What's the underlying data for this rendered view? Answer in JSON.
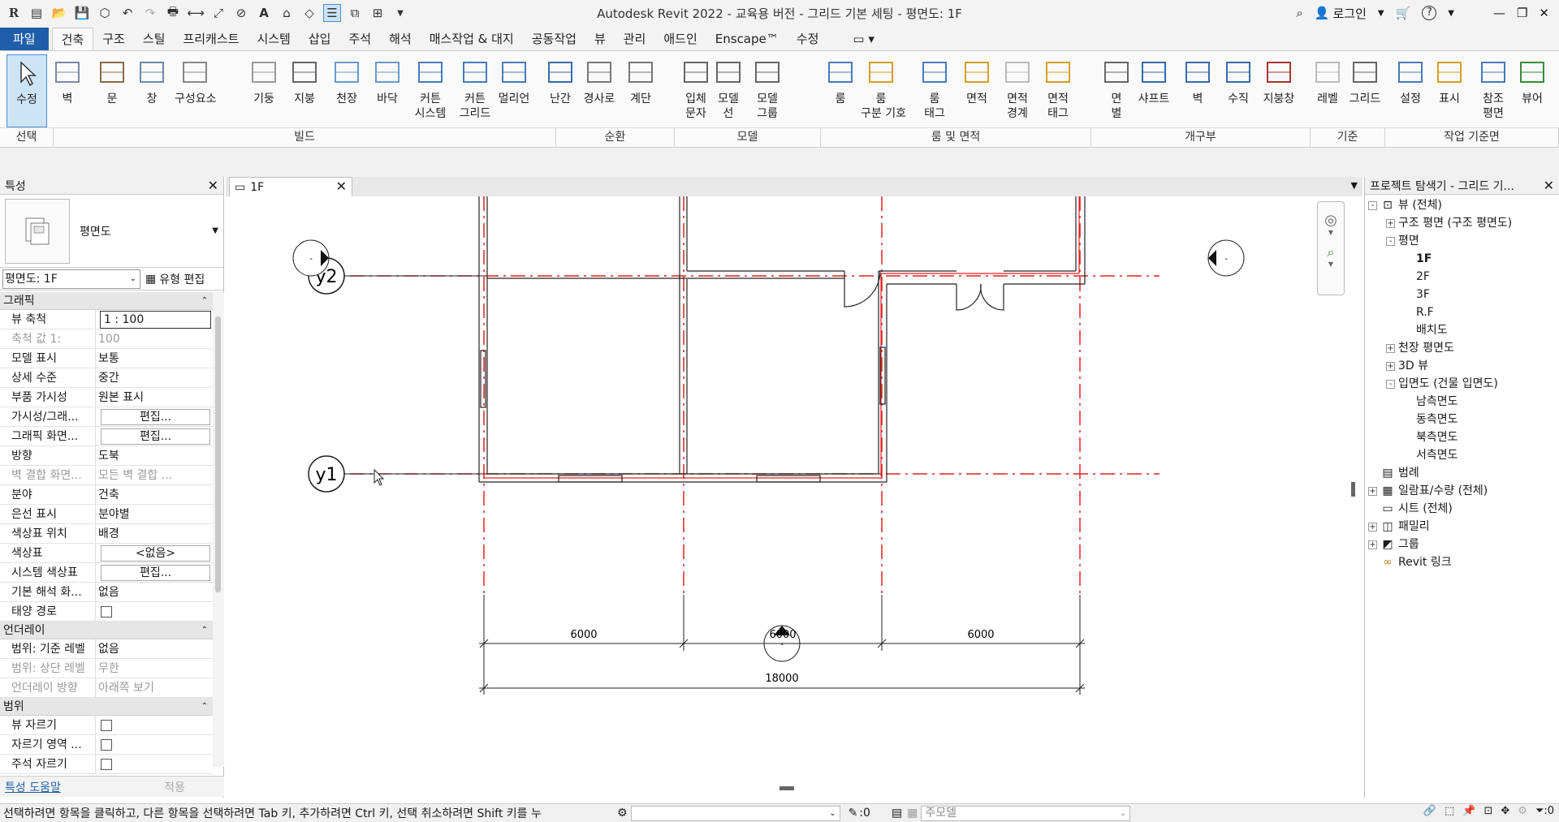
{
  "window": {
    "title": "Autodesk Revit 2022 - 교육용 버전 - 그리드 기본 세팅 - 평면도: 1F",
    "login": "로그인",
    "help": "?"
  },
  "menu": [
    "파일",
    "건축",
    "구조",
    "스틸",
    "프리캐스트",
    "시스템",
    "삽입",
    "주석",
    "해석",
    "매스작업 & 대지",
    "공동작업",
    "뷰",
    "관리",
    "애드인",
    "Enscape™",
    "수정"
  ],
  "ribbon": {
    "buttons": [
      "수정",
      "벽",
      "문",
      "창",
      "구성요소",
      "기둥",
      "지붕",
      "천장",
      "바닥",
      "커튼\n시스템",
      "커튼\n그리드",
      "멀리언",
      "난간",
      "경사로",
      "계단",
      "입체\n문자",
      "모델\n선",
      "모델\n그룹",
      "룸",
      "룸\n구분 기호",
      "룸\n태그",
      "면적",
      "면적\n경계",
      "면적\n태그",
      "면\n별",
      "샤프트",
      "벽",
      "수직",
      "지붕창",
      "레벨",
      "그리드",
      "설정",
      "표시",
      "참조\n평면",
      "뷰어"
    ],
    "panels": [
      "선택",
      "빌드",
      "순환",
      "모델",
      "룸 및 면적",
      "개구부",
      "기준",
      "작업 기준면"
    ]
  },
  "properties": {
    "title": "특성",
    "type_name": "평면도",
    "instance": "평면도: 1F",
    "edit_type": "유형 편집",
    "groups": [
      {
        "name": "그래픽",
        "rows": [
          {
            "k": "뷰 축척",
            "v": "1 : 100",
            "style": "boxed"
          },
          {
            "k": "축척 값    1:",
            "v": "100",
            "style": "dim"
          },
          {
            "k": "모델 표시",
            "v": "보통"
          },
          {
            "k": "상세 수준",
            "v": "중간"
          },
          {
            "k": "부품 가시성",
            "v": "원본 표시"
          },
          {
            "k": "가시성/그래...",
            "v": "편집...",
            "style": "btn"
          },
          {
            "k": "그래픽 화면...",
            "v": "편집...",
            "style": "btn"
          },
          {
            "k": "방향",
            "v": "도북"
          },
          {
            "k": "벽 결합 화면...",
            "v": "모든 벽 결합 ...",
            "style": "dim"
          },
          {
            "k": "분야",
            "v": "건축"
          },
          {
            "k": "은선 표시",
            "v": "분야별"
          },
          {
            "k": "색상표 위치",
            "v": "배경"
          },
          {
            "k": "색상표",
            "v": "<없음>",
            "style": "btn"
          },
          {
            "k": "시스템 색상표",
            "v": "편집...",
            "style": "btn"
          },
          {
            "k": "기본 해석 화...",
            "v": "없음"
          },
          {
            "k": "태양 경로",
            "v": "",
            "style": "check"
          }
        ]
      },
      {
        "name": "언더레이",
        "rows": [
          {
            "k": "범위: 기준 레벨",
            "v": "없음"
          },
          {
            "k": "범위: 상단 레벨",
            "v": "무한",
            "style": "dim"
          },
          {
            "k": "언더레이 방향",
            "v": "아래쪽 보기",
            "style": "dim"
          }
        ]
      },
      {
        "name": "범위",
        "rows": [
          {
            "k": "뷰 자르기",
            "v": "",
            "style": "check"
          },
          {
            "k": "자르기 영역 ...",
            "v": "",
            "style": "check"
          },
          {
            "k": "주석 자르기",
            "v": "",
            "style": "check"
          }
        ]
      }
    ],
    "help_link": "특성 도움말",
    "apply": "적용"
  },
  "view_tab": {
    "label": "1F"
  },
  "drawing": {
    "grid_bubbles": [
      "y2",
      "y1"
    ],
    "dims": [
      "6000",
      "6000",
      "6000",
      "18000"
    ],
    "elev_marker": "-"
  },
  "browser": {
    "title": "프로젝트 탐색기 - 그리드 기...",
    "nodes": [
      {
        "label": "뷰 (전체)",
        "level": 0,
        "exp": "-",
        "icon": "view"
      },
      {
        "label": "구조 평면 (구조 평면도)",
        "level": 1,
        "exp": "+"
      },
      {
        "label": "평면",
        "level": 1,
        "exp": "-"
      },
      {
        "label": "1F",
        "level": 2,
        "bold": true
      },
      {
        "label": "2F",
        "level": 2
      },
      {
        "label": "3F",
        "level": 2
      },
      {
        "label": "R.F",
        "level": 2
      },
      {
        "label": "배치도",
        "level": 2
      },
      {
        "label": "천장 평면도",
        "level": 1,
        "exp": "+"
      },
      {
        "label": "3D 뷰",
        "level": 1,
        "exp": "+"
      },
      {
        "label": "입면도 (건물 입면도)",
        "level": 1,
        "exp": "-"
      },
      {
        "label": "남측면도",
        "level": 2
      },
      {
        "label": "동측면도",
        "level": 2
      },
      {
        "label": "북측면도",
        "level": 2
      },
      {
        "label": "서측면도",
        "level": 2
      },
      {
        "label": "범례",
        "level": 0,
        "icon": "legend"
      },
      {
        "label": "일람표/수량 (전체)",
        "level": 0,
        "exp": "+",
        "icon": "table"
      },
      {
        "label": "시트 (전체)",
        "level": 0,
        "icon": "sheet"
      },
      {
        "label": "패밀리",
        "level": 0,
        "exp": "+",
        "icon": "family"
      },
      {
        "label": "그룹",
        "level": 0,
        "exp": "+",
        "icon": "group"
      },
      {
        "label": "Revit 링크",
        "level": 0,
        "icon": "link"
      }
    ]
  },
  "status": {
    "text": "선택하려면 항목을 클릭하고, 다른 항목을 선택하려면 Tab 키, 추가하려면 Ctrl 키, 선택 취소하려면 Shift 키를 누",
    "count": ":0",
    "model": "주모델",
    "filter": ":0"
  }
}
